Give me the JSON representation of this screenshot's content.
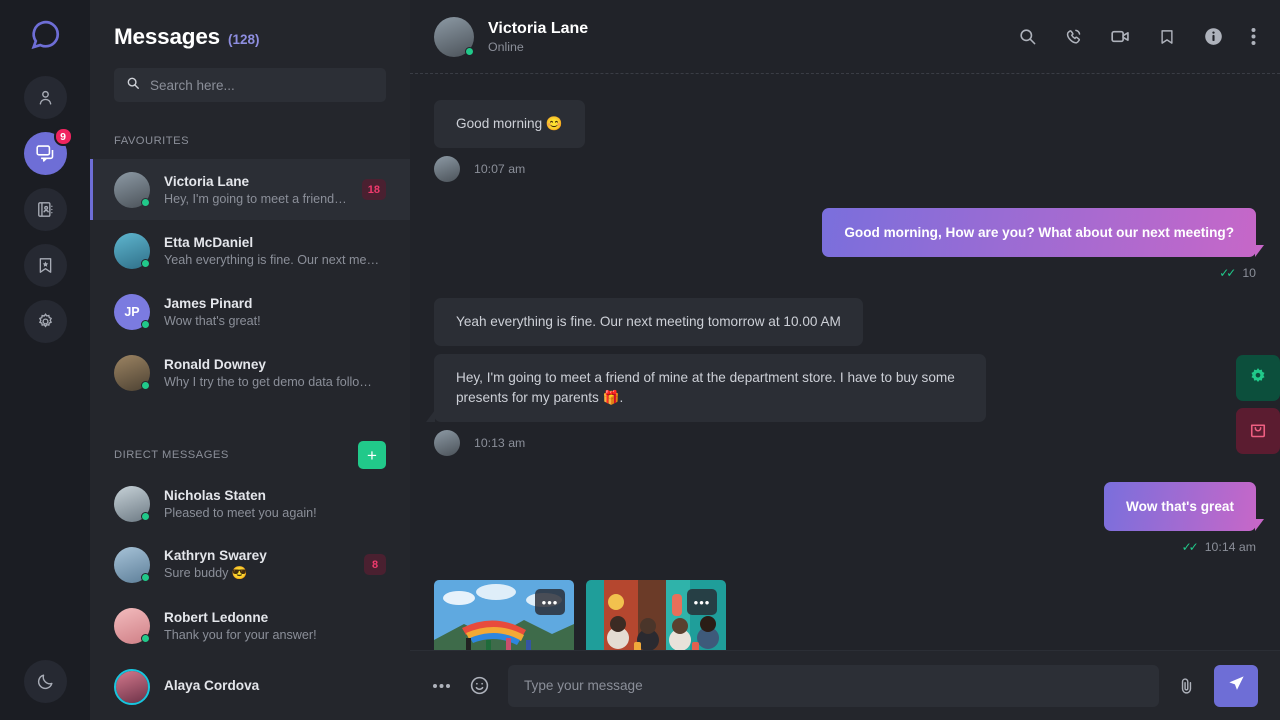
{
  "rail": {
    "logo_icon": "chat-logo-icon",
    "items": [
      {
        "icon": "user-icon",
        "name": "profile",
        "active": false,
        "badge": ""
      },
      {
        "icon": "chats-icon",
        "name": "chats",
        "active": true,
        "badge": "9"
      },
      {
        "icon": "contacts-icon",
        "name": "contacts",
        "active": false,
        "badge": ""
      },
      {
        "icon": "bookmark-star-icon",
        "name": "saved",
        "active": false,
        "badge": ""
      },
      {
        "icon": "gear-icon",
        "name": "settings",
        "active": false,
        "badge": ""
      }
    ],
    "theme_toggle_icon": "moon-icon"
  },
  "sidebar": {
    "title": "Messages",
    "count": "(128)",
    "search": {
      "placeholder": "Search here...",
      "value": "",
      "icon": "search-icon"
    },
    "favourites_label": "FAVOURITES",
    "direct_label": "DIRECT MESSAGES",
    "add_label": "+",
    "favourites": [
      {
        "name": "Victoria Lane",
        "preview": "Hey, I'm going to meet a friend of",
        "badge": "18",
        "online": true,
        "initials": "",
        "avatar_color": "#6c7a89",
        "active": true,
        "ring": false
      },
      {
        "name": "Etta McDaniel",
        "preview": "Yeah everything is fine. Our next me…",
        "badge": "",
        "online": true,
        "initials": "",
        "avatar_color": "#3f8fa8",
        "active": false,
        "ring": false
      },
      {
        "name": "James Pinard",
        "preview": "Wow that's great!",
        "badge": "",
        "online": true,
        "initials": "JP",
        "avatar_color": "#7b7be0",
        "active": false,
        "ring": false
      },
      {
        "name": "Ronald Downey",
        "preview": "Why I try the to get demo data follo…",
        "badge": "",
        "online": true,
        "initials": "",
        "avatar_color": "#7a6a52",
        "active": false,
        "ring": false
      }
    ],
    "direct_messages": [
      {
        "name": "Nicholas Staten",
        "preview": "Pleased to meet you again!",
        "badge": "",
        "online": true,
        "initials": "",
        "avatar_color": "#9aa7b0",
        "active": false,
        "ring": false
      },
      {
        "name": "Kathryn Swarey",
        "preview": "Sure buddy 😎",
        "badge": "8",
        "online": true,
        "initials": "",
        "avatar_color": "#89a6bd",
        "active": false,
        "ring": false
      },
      {
        "name": "Robert Ledonne",
        "preview": "Thank you for your answer!",
        "badge": "",
        "online": true,
        "initials": "",
        "avatar_color": "#e9a8ab",
        "active": false,
        "ring": false
      },
      {
        "name": "Alaya Cordova",
        "preview": "",
        "badge": "",
        "online": false,
        "initials": "",
        "avatar_color": "#b0556a",
        "active": false,
        "ring": true
      }
    ]
  },
  "chat": {
    "contact_name": "Victoria Lane",
    "contact_status": "Online",
    "avatar_color": "#6c7a89",
    "actions": [
      {
        "icon": "search-icon",
        "name": "search-conversation"
      },
      {
        "icon": "phone-call-icon",
        "name": "voice-call"
      },
      {
        "icon": "video-camera-icon",
        "name": "video-call"
      },
      {
        "icon": "bookmark-icon",
        "name": "bookmark-conversation"
      },
      {
        "icon": "info-icon",
        "name": "contact-info"
      },
      {
        "icon": "more-vertical-icon",
        "name": "more-options"
      }
    ],
    "messages": [
      {
        "type": "in",
        "text": "Good morning 😊",
        "time": "10:07 am",
        "tail": false
      },
      {
        "type": "out",
        "text": "Good morning, How are you? What about our next meeting?",
        "time": "10",
        "ticks": "✓✓"
      },
      {
        "type": "in",
        "text": "Yeah everything is fine. Our next meeting tomorrow at 10.00 AM",
        "time": "",
        "tail": false
      },
      {
        "type": "in",
        "text": "Hey, I'm going to meet a friend of mine at the department store. I have to buy some presents for my parents 🎁.",
        "time": "10:13 am",
        "tail": true
      },
      {
        "type": "out",
        "text": "Wow that's great",
        "time": "10:14 am",
        "ticks": "✓✓"
      }
    ],
    "attachments": [
      {
        "name": "photo-parachute-children",
        "overlay": "•••"
      },
      {
        "name": "photo-friends-mural",
        "overlay": "•••"
      }
    ],
    "float_buttons": [
      {
        "icon": "gear-icon",
        "name": "chat-settings",
        "color": "#0c4f3c"
      },
      {
        "icon": "shopping-bag-icon",
        "name": "shop",
        "color": "#5b1c30"
      }
    ],
    "composer": {
      "more_icon": "more-horizontal-icon",
      "emoji_icon": "emoji-smile-icon",
      "placeholder": "Type your message",
      "value": "",
      "attach_icon": "paperclip-icon",
      "send_icon": "send-icon"
    }
  },
  "colors": {
    "accent_purple": "#6e6ed6",
    "accent_green": "#21c98a",
    "badge_pink": "#ef3a6d",
    "bubble_gradient_start": "#7a6fdc",
    "bubble_gradient_end": "#c667c8"
  }
}
